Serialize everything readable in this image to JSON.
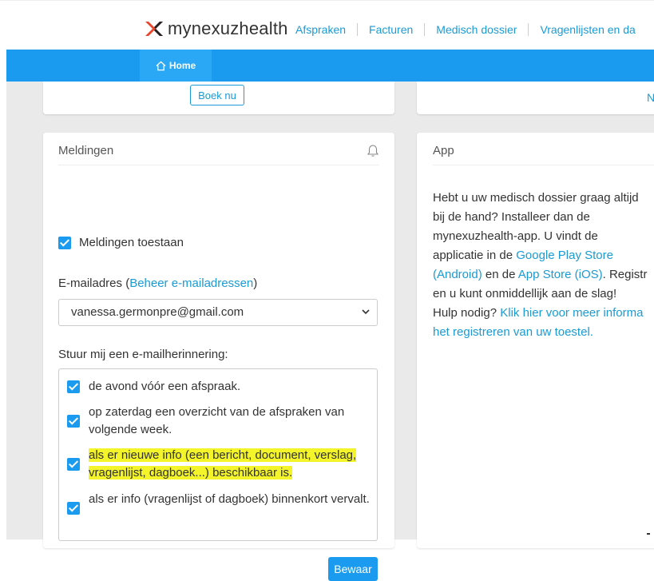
{
  "header": {
    "logo_text": "mynexuzhealth",
    "nav": [
      "Afspraken",
      "Facturen",
      "Medisch dossier",
      "Vragenlijsten en da"
    ]
  },
  "bluebar": {
    "home_label": "Home"
  },
  "top_cards": {
    "boek_label": "Boek nu",
    "right_fragment": "N"
  },
  "meldingen": {
    "title": "Meldingen",
    "allow_label": "Meldingen toestaan",
    "allow_checked": true,
    "email_label_prefix": "E-mailadres (",
    "email_label_link": "Beheer e-mailadressen",
    "email_label_suffix": ")",
    "email_value": "vanessa.germonpre@gmail.com",
    "remind_label": "Stuur mij een e-mailherinnering:",
    "options": [
      {
        "label": "de avond vóór een afspraak.",
        "checked": true
      },
      {
        "label": "op zaterdag een overzicht van de afspraken van volgende week.",
        "checked": true
      },
      {
        "label": "als er nieuwe info (een bericht, document, verslag, vragenlijst, dagboek...) beschikbaar is.",
        "checked": true,
        "highlighted": true
      },
      {
        "label": "als er info (vragenlijst of dagboek) binnenkort vervalt.",
        "checked": true
      }
    ],
    "save_label": "Bewaar"
  },
  "app": {
    "title": "App",
    "line1": "Hebt u uw medisch dossier graag altijd",
    "line2": "bij de hand? Installeer dan de",
    "line3": "mynexuzhealth-app. U vindt de",
    "line4_prefix": "applicatie in de ",
    "line4_link": "Google Play Store",
    "line5_link": "(Android)",
    "line5_mid": " en de ",
    "line5_link2": "App Store (iOS)",
    "line5_suffix": ". Registr",
    "line6": "en u kunt onmiddellijk aan de slag!",
    "line7_prefix": "Hulp nodig? ",
    "line7_link": "Klik hier voor meer informa",
    "line8_link": "het registreren van uw toestel."
  },
  "colors": {
    "accent": "#1a9bf0",
    "link": "#1a9bd7",
    "highlight": "#f4f42a"
  }
}
